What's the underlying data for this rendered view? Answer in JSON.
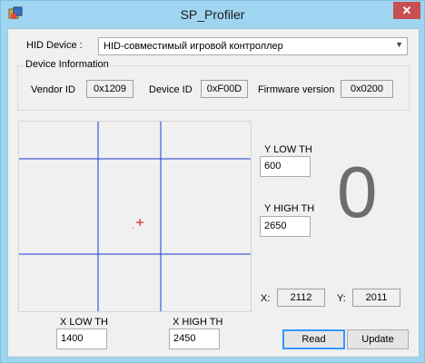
{
  "window": {
    "title": "SP_Profiler",
    "close_glyph": "✕"
  },
  "device": {
    "label": "HID Device :",
    "selected": "HID-совместимый игровой контроллер"
  },
  "info": {
    "group_title": "Device Information",
    "vendor_label": "Vendor ID",
    "vendor_value": "0x1209",
    "device_label": "Device ID",
    "device_value": "0xF00D",
    "firmware_label": "Firmware version",
    "firmware_value": "0x0200"
  },
  "thresholds": {
    "y_low_label": "Y LOW TH",
    "y_low": "600",
    "y_high_label": "Y HIGH TH",
    "y_high": "2650",
    "x_low_label": "X LOW TH",
    "x_low": "1400",
    "x_high_label": "X HIGH TH",
    "x_high": "2450"
  },
  "position": {
    "x_label": "X:",
    "x": "2112",
    "y_label": "Y:",
    "y": "2011"
  },
  "state_value": "0",
  "buttons": {
    "read": "Read",
    "update": "Update"
  },
  "colors": {
    "window_frame": "#9fd5f0",
    "threshold_lines": "#1a3ad6",
    "marker": "#cc0000"
  }
}
